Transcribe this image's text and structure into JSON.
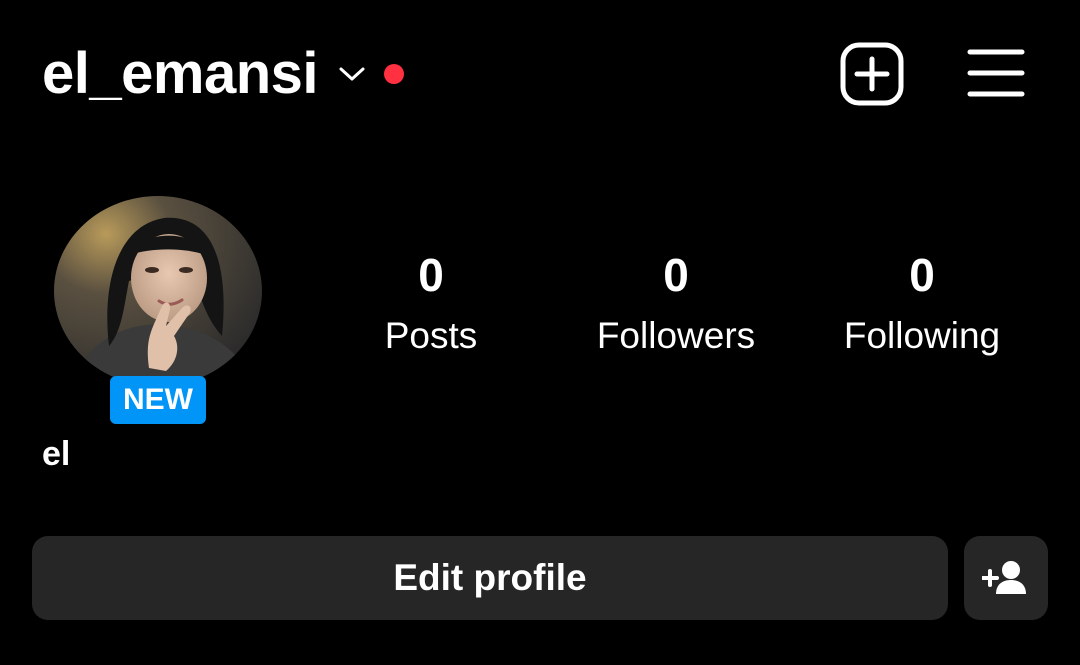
{
  "header": {
    "username": "el_emansi",
    "switcher_icon": "chevron-down-icon",
    "has_notification": true,
    "create_icon": "plus-square-icon",
    "menu_icon": "hamburger-menu-icon"
  },
  "profile": {
    "avatar_alt": "profile photo",
    "badge_label": "NEW",
    "display_name": "el"
  },
  "stats": [
    {
      "value": "0",
      "label": "Posts"
    },
    {
      "value": "0",
      "label": "Followers"
    },
    {
      "value": "0",
      "label": "Following"
    }
  ],
  "actions": {
    "edit_profile_label": "Edit profile",
    "discover_icon": "add-person-icon"
  },
  "colors": {
    "background": "#000000",
    "text": "#ffffff",
    "notification_dot": "#ff3040",
    "badge": "#0095f6",
    "button_surface": "#262626"
  }
}
